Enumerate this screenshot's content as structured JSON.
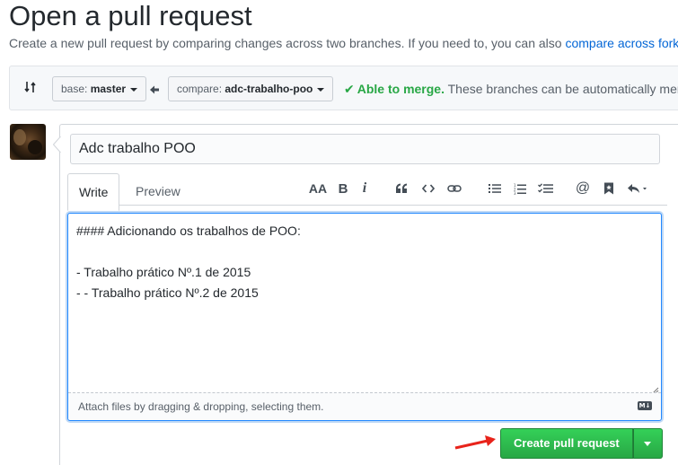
{
  "header": {
    "title": "Open a pull request",
    "subtitle": "Create a new pull request by comparing changes across two branches. If you need to, you can also",
    "subtitle_link": "compare across forks."
  },
  "range": {
    "base_prefix": "base:",
    "base_branch": "master",
    "compare_prefix": "compare:",
    "compare_branch": "adc-trabalho-poo",
    "merge_ok": "Able to merge.",
    "merge_desc": "These branches can be automatically merged."
  },
  "form": {
    "title_value": "Adc trabalho POO",
    "tabs": [
      "Write",
      "Preview"
    ],
    "body_value": "#### Adicionando os trabalhos de POO:\n\n- Trabalho prático Nº.1 de 2015\n- - Trabalho prático Nº.2 de 2015",
    "attach_text": "Attach files by dragging & dropping, selecting them.",
    "markdown_badge": "M↓"
  },
  "toolbar": {
    "header_label": "AA",
    "bold_label": "B",
    "italic_label": "i",
    "mention_label": "@",
    "icons": [
      "header-icon",
      "bold-icon",
      "italic-icon",
      "quote-icon",
      "code-icon",
      "link-icon",
      "unordered-list-icon",
      "ordered-list-icon",
      "task-list-icon",
      "mention-icon",
      "saved-reply-icon",
      "reply-icon"
    ]
  },
  "actions": {
    "create_label": "Create pull request"
  },
  "colors": {
    "accent": "#0366d6",
    "success": "#28a745",
    "annotation_arrow": "#e8231b"
  }
}
